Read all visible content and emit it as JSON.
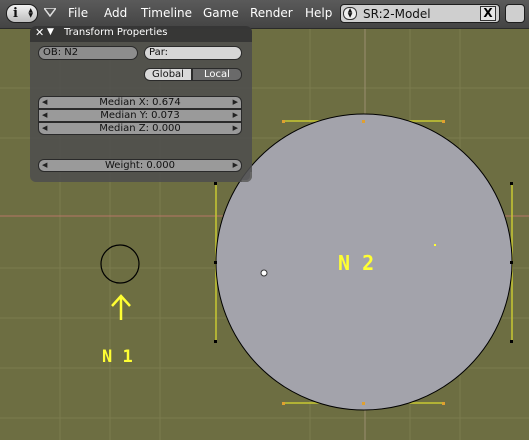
{
  "header": {
    "menu": [
      "File",
      "Add",
      "Timeline",
      "Game",
      "Render",
      "Help"
    ],
    "scene_name": "SR:2-Model",
    "scene_close": "X",
    "info_icon": "i"
  },
  "panel": {
    "title": "Transform Properties",
    "close_glyph": "✕",
    "collapse_glyph": "▼",
    "object_field": "OB: N2",
    "parent_field": "Par:",
    "global_label": "Global",
    "local_label": "Local",
    "median_x": "Median X: 0.674",
    "median_y": "Median Y: 0.073",
    "median_z": "Median Z: 0.000",
    "weight": "Weight: 0.000"
  },
  "viewport": {
    "label_n1": "N 1",
    "label_n2": "N 2",
    "arrow_glyph": "↑"
  },
  "colors": {
    "viewport_bg": "#6d6e42",
    "grid_line": "#7b7c4f",
    "axis_line": "#b87766",
    "annotation": "#ffff33",
    "selected_edge": "#c8c832",
    "circle_fill": "#a3a3ab"
  },
  "icons": [
    "info-icon",
    "collapse-triangle-icon",
    "scene-updown-icon",
    "close-icon",
    "arrow-left-icon",
    "arrow-right-icon"
  ]
}
